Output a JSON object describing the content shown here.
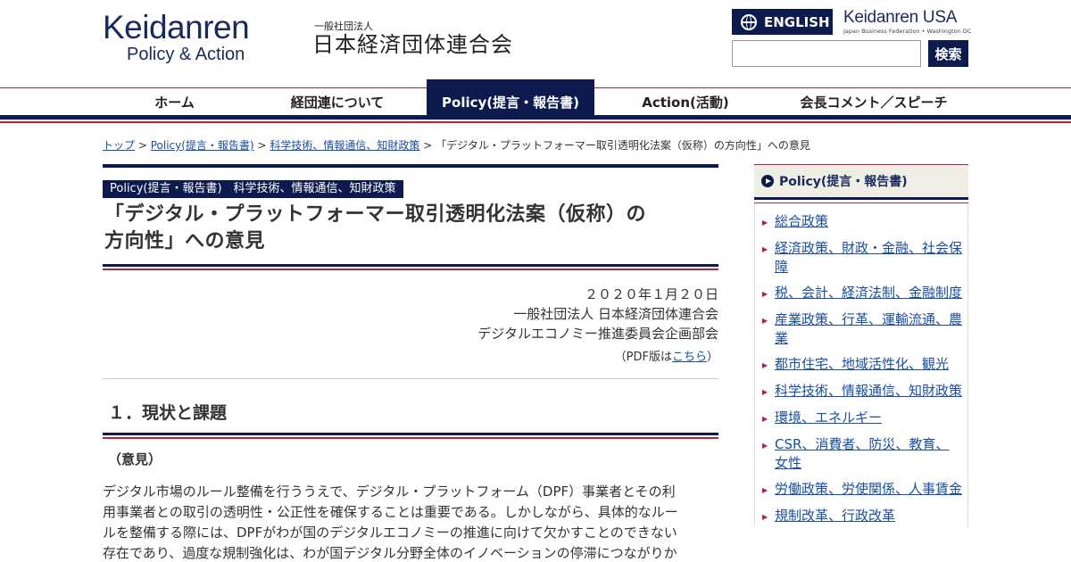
{
  "header": {
    "logo_main": "Keidanren",
    "logo_sub": "Policy & Action",
    "org_type": "一般社団法人",
    "org_name": "日本経済団体連合会",
    "english_label": "ENGLISH",
    "usa_main": "Keidanren USA",
    "usa_sub": "Japan Business Federation • Washington DC",
    "search_placeholder": "",
    "search_label": "検索"
  },
  "nav": {
    "items": [
      {
        "label": "ホーム"
      },
      {
        "label": "経団連について"
      },
      {
        "label": "Policy(提言・報告書)"
      },
      {
        "label": "Action(活動)"
      },
      {
        "label": "会長コメント／スピーチ"
      }
    ]
  },
  "breadcrumb": {
    "items": [
      "トップ",
      "Policy(提言・報告書)",
      "科学技術、情報通信、知財政策"
    ],
    "separator": ">",
    "current": "「デジタル・プラットフォーマー取引透明化法案（仮称）の方向性」への意見"
  },
  "article": {
    "category": "Policy(提言・報告書)　科学技術、情報通信、知財政策",
    "title_line1": "「デジタル・プラットフォーマー取引透明化法案（仮称）の",
    "title_line2": "方向性」への意見",
    "date": "２０２０年１月２０日",
    "org": "一般社団法人 日本経済団体連合会",
    "committee": "デジタルエコノミー推進委員会企画部会",
    "pdf_prefix": "（PDF版は",
    "pdf_link": "こちら",
    "pdf_suffix": "）",
    "section_heading": "１．現状と課題",
    "sub_heading": "（意見）",
    "body_lines": [
      "デジタル市場のルール整備を行ううえで、デジタル・プラットフォーム（DPF）事業者とその利",
      "用事業者との取引の透明性・公正性を確保することは重要である。しかしながら、具体的なルー",
      "ルを整備する際には、DPFがわが国のデジタルエコノミーの推進に向けて欠かすことのできない",
      "存在であり、過度な規制強化は、わが国デジタル分野全体のイノベーションの停滞につながりか"
    ]
  },
  "sidebar": {
    "heading": "Policy(提言・報告書)",
    "items": [
      {
        "label": "総合政策"
      },
      {
        "label": "経済政策、財政・金融、社会保障"
      },
      {
        "label": "税、会計、経済法制、金融制度"
      },
      {
        "label": "産業政策、行革、運輸流通、農業"
      },
      {
        "label": "都市住宅、地域活性化、観光"
      },
      {
        "label": "科学技術、情報通信、知財政策"
      },
      {
        "label": "環境、エネルギー"
      },
      {
        "label": "CSR、消費者、防災、教育、女性"
      },
      {
        "label": "労働政策、労使関係、人事賃金"
      },
      {
        "label": "規制改革、行政改革"
      }
    ]
  }
}
